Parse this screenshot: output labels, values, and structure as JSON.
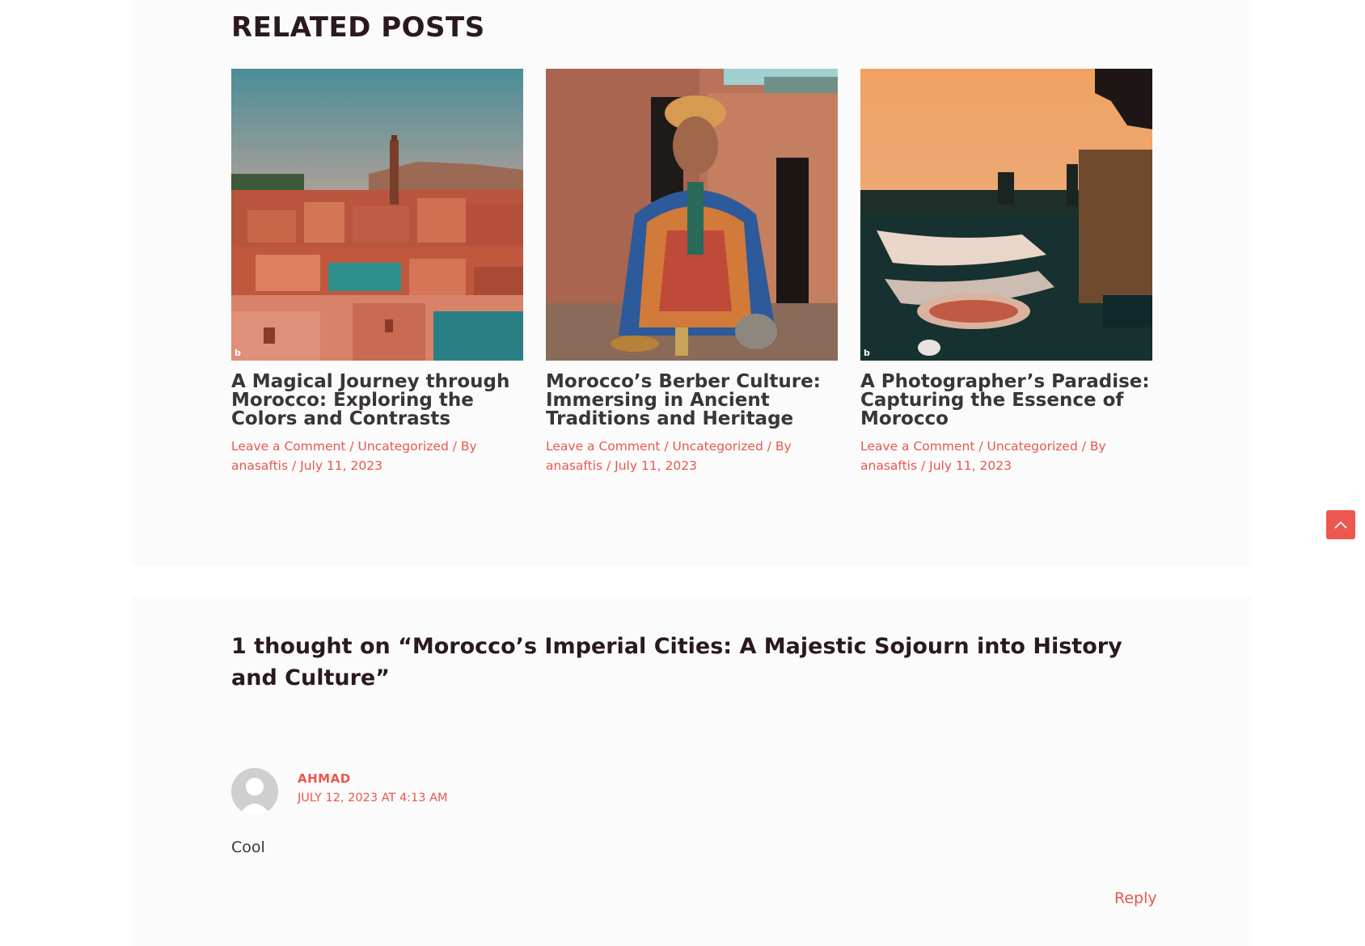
{
  "related": {
    "heading": "RELATED POSTS",
    "posts": [
      {
        "title": "A Magical Journey through Morocco: Exploring the Colors and Contrasts",
        "comment_link": "Leave a Comment",
        "category": "Uncategorized",
        "by": "By",
        "author": "anasaftis",
        "date": "July 11, 2023",
        "image": "moroccan-hill-town-photo"
      },
      {
        "title": "Morocco’s Berber Culture: Immersing in Ancient Traditions and Heritage",
        "comment_link": "Leave a Comment",
        "category": "Uncategorized",
        "by": "By",
        "author": "anasaftis",
        "date": "July 11, 2023",
        "image": "berber-man-portrait-photo"
      },
      {
        "title": "A Photographer’s Paradise: Capturing the Essence of Morocco",
        "comment_link": "Leave a Comment",
        "category": "Uncategorized",
        "by": "By",
        "author": "anasaftis",
        "date": "July 11, 2023",
        "image": "sunset-waterfront-photo"
      }
    ]
  },
  "comments": {
    "title": "1 thought on “Morocco’s Imperial Cities: A Majestic Sojourn into History and Culture”",
    "items": [
      {
        "author": "AHMAD",
        "date": "JULY 12, 2023 AT 4:13 AM",
        "text": "Cool",
        "reply_label": "Reply"
      }
    ]
  },
  "controls": {
    "scroll_top_icon": "chevron-up-icon"
  },
  "colors": {
    "accent": "#e8574f",
    "heading": "#2a1a1d",
    "button": "#ec5850"
  }
}
